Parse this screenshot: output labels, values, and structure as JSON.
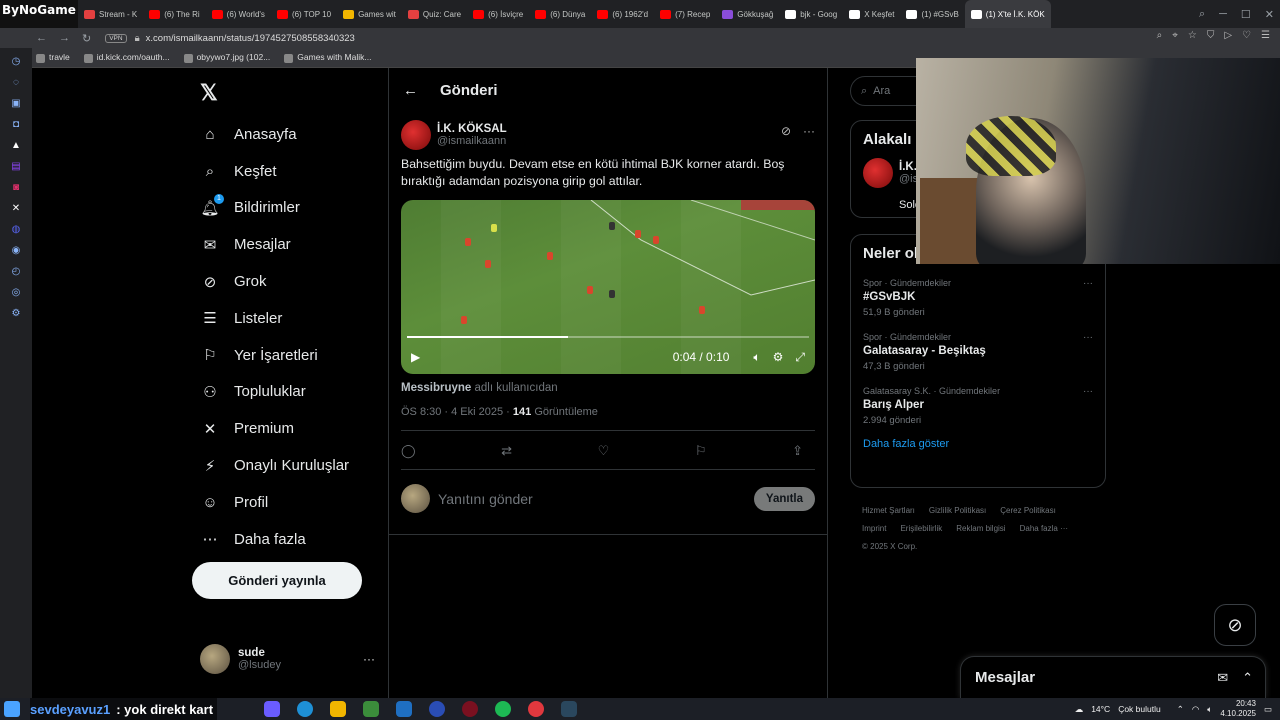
{
  "browser": {
    "brand": "ByNoGame",
    "tabs": [
      {
        "label": "Stream - K",
        "color": "#e34040"
      },
      {
        "label": "(6) The Ri",
        "color": "#ff0000"
      },
      {
        "label": "(6) World's",
        "color": "#ff0000"
      },
      {
        "label": "(6) TOP 10",
        "color": "#ff0000"
      },
      {
        "label": "Games wit",
        "color": "#f2b600"
      },
      {
        "label": "Quiz: Care",
        "color": "#e34040"
      },
      {
        "label": "(6) İsviçre",
        "color": "#ff0000"
      },
      {
        "label": "(6) Dünya",
        "color": "#ff0000"
      },
      {
        "label": "(6) 1962'd",
        "color": "#ff0000"
      },
      {
        "label": "(7) Recep",
        "color": "#ff0000"
      },
      {
        "label": "Gökkuşağ",
        "color": "#8a4dd9"
      },
      {
        "label": "bjk - Goog",
        "color": "#ffffff"
      },
      {
        "label": "X Keşfet",
        "color": "#ffffff"
      },
      {
        "label": "(1) #GSvB",
        "color": "#ffffff"
      },
      {
        "label": "(1) X'te İ.K. KÖK",
        "color": "#ffffff"
      }
    ],
    "vpn_label": "VPN",
    "url": "x.com/ismailkaann/status/1974527508558340323",
    "bookmarks": [
      "travle",
      "id.kick.com/oauth...",
      "obyywo7.jpg (102...",
      "Games with Malik..."
    ]
  },
  "nav": {
    "items": [
      {
        "label": "Anasayfa",
        "icon": "home-icon"
      },
      {
        "label": "Keşfet",
        "icon": "search-icon"
      },
      {
        "label": "Bildirimler",
        "icon": "bell-icon",
        "badge": "1"
      },
      {
        "label": "Mesajlar",
        "icon": "mail-icon"
      },
      {
        "label": "Grok",
        "icon": "grok-icon"
      },
      {
        "label": "Listeler",
        "icon": "list-icon"
      },
      {
        "label": "Yer İşaretleri",
        "icon": "bookmark-icon"
      },
      {
        "label": "Topluluklar",
        "icon": "communities-icon"
      },
      {
        "label": "Premium",
        "icon": "x-icon"
      },
      {
        "label": "Onaylı Kuruluşlar",
        "icon": "lightning-icon"
      },
      {
        "label": "Profil",
        "icon": "person-icon"
      },
      {
        "label": "Daha fazla",
        "icon": "more-circle-icon"
      }
    ],
    "post_button": "Gönderi yayınla",
    "account": {
      "name": "sude",
      "handle": "@lsudey",
      "more": "···"
    }
  },
  "post_view": {
    "title": "Gönderi",
    "author": {
      "name": "İ.K. KÖKSAL",
      "handle": "@ismailkaann"
    },
    "text": "Bahsettiğim buydu. Devam etse en kötü ihtimal BJK korner atardı. Boş bıraktığı adamdan pozisyona girip gol attılar.",
    "video": {
      "time": "0:04 / 0:10",
      "progress": 0.4
    },
    "attribution_user": "Messibruyne",
    "attribution_suffix": "adlı kullanıcıdan",
    "time": "ÖS 8:30 · 4 Eki 2025 ·",
    "views_count": "141",
    "views_label": "Görüntüleme",
    "reply_placeholder": "Yanıtını gönder",
    "reply_button": "Yanıtla"
  },
  "sidebar": {
    "search_placeholder": "Ara",
    "related_title": "Alakalı",
    "related_name": "İ.K.",
    "related_handle": "@is",
    "related_follow": "Sole",
    "trends_title": "Neler ol",
    "trends": [
      {
        "category": "Spor · Gündemdekiler",
        "name": "#GSvBJK",
        "count": "51,9 B gönderi"
      },
      {
        "category": "Spor · Gündemdekiler",
        "name": "Galatasaray - Beşiktaş",
        "count": "47,3 B gönderi"
      },
      {
        "category": "Galatasaray S.K. · Gündemdekiler",
        "name": "Barış Alper",
        "count": "2.994 gönderi"
      }
    ],
    "show_more": "Daha fazla göster",
    "footer": [
      "Hizmet Şartları",
      "Gizlilik Politikası",
      "Çerez Politikası",
      "Imprint",
      "Erişilebilirlik",
      "Reklam bilgisi",
      "Daha fazla ···",
      "© 2025 X Corp."
    ]
  },
  "messages_drawer": {
    "title": "Mesajlar"
  },
  "taskbar": {
    "chat_user": "sevdeyavuz1",
    "chat_message": ": yok direkt kart",
    "weather": "14°C",
    "weather_desc": "Çok bulutlu",
    "time": "20:43",
    "date": "4.10.2025"
  }
}
